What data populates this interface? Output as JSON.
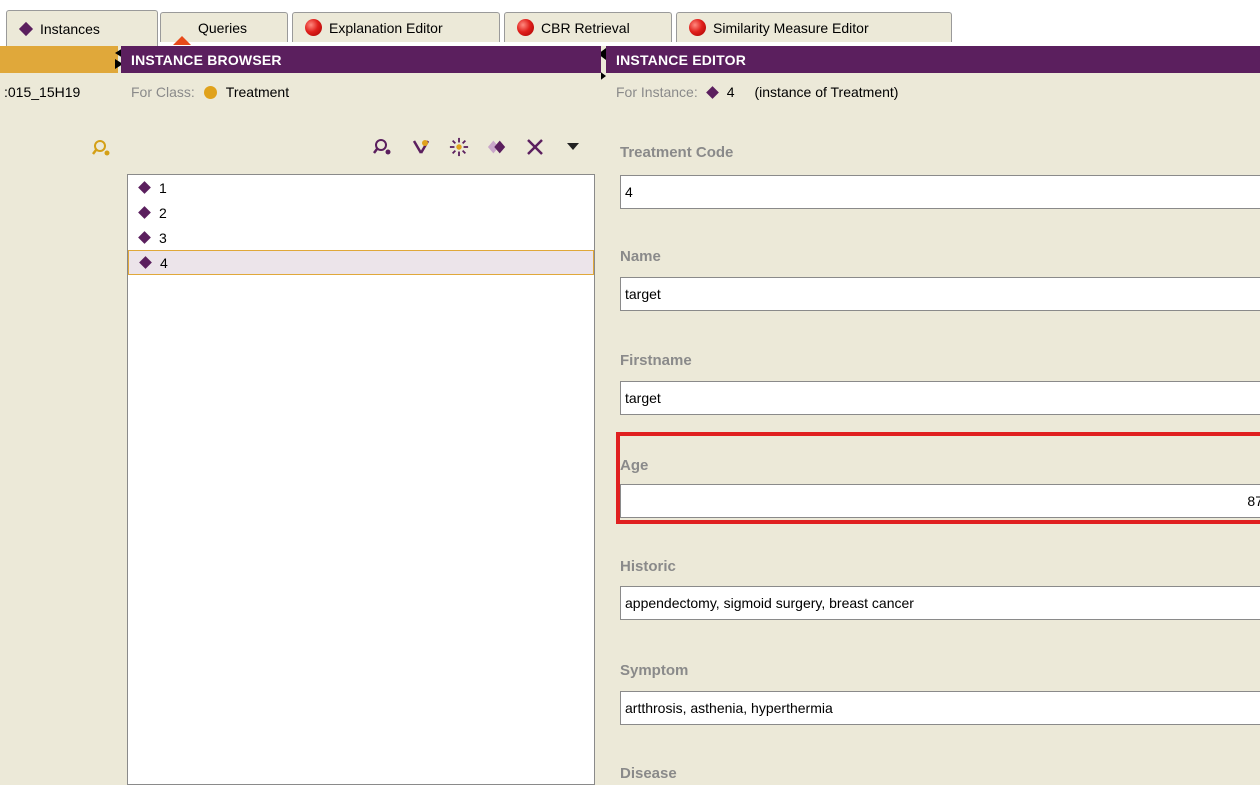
{
  "tabs": [
    {
      "label": "Instances",
      "icon": "diamond-icon",
      "active": true
    },
    {
      "label": "Queries",
      "icon": "cone-icon",
      "active": false
    },
    {
      "label": "Explanation Editor",
      "icon": "red-ball-icon",
      "active": false
    },
    {
      "label": "CBR Retrieval",
      "icon": "red-ball-icon",
      "active": false
    },
    {
      "label": "Similarity Measure Editor",
      "icon": "red-ball-icon",
      "active": false
    }
  ],
  "left_panel": {
    "project_label": ":015_15H19"
  },
  "instance_browser": {
    "title": "INSTANCE BROWSER",
    "for_label": "For Class:",
    "class_name": "Treatment",
    "items": [
      {
        "label": "1",
        "selected": false
      },
      {
        "label": "2",
        "selected": false
      },
      {
        "label": "3",
        "selected": false
      },
      {
        "label": "4",
        "selected": true
      }
    ]
  },
  "instance_editor": {
    "title": "INSTANCE EDITOR",
    "for_label": "For Instance:",
    "instance_name": "4",
    "instance_of": "(instance of Treatment)",
    "fields": {
      "treatment_code": {
        "label": "Treatment Code",
        "value": "4"
      },
      "name": {
        "label": "Name",
        "value": "target"
      },
      "firstname": {
        "label": "Firstname",
        "value": "target"
      },
      "age": {
        "label": "Age",
        "value": "87"
      },
      "historic": {
        "label": "Historic",
        "value": "appendectomy, sigmoid surgery, breast cancer"
      },
      "symptom": {
        "label": "Symptom",
        "value": "artthrosis, asthenia, hyperthermia"
      },
      "disease": {
        "label": "Disease"
      }
    }
  },
  "colors": {
    "header_purple": "#5b1f5e",
    "header_gold": "#e0a83a",
    "highlight_red": "#e02020",
    "panel_bg": "#ece9d8"
  }
}
